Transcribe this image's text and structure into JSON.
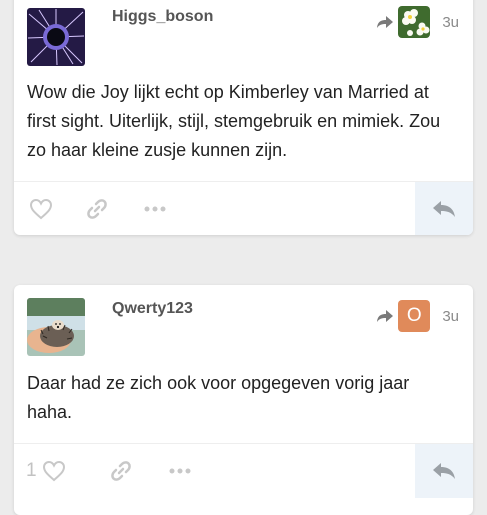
{
  "posts": [
    {
      "username": "Higgs_boson",
      "avatar_icon": "dark-sphere-avatar",
      "reply_to_avatar_icon": "white-flowers-avatar",
      "age": "3u",
      "body": "Wow die Joy lijkt echt op Kimberley van Married at first sight. Uiterlijk, stijl, stemgebruik en mimiek. Zou zo haar kleine zusje kunnen zijn.",
      "like_count": "",
      "icons": [
        "heart-icon",
        "link-icon",
        "more-icon",
        "reply-icon"
      ]
    },
    {
      "username": "Qwerty123",
      "avatar_icon": "hedgehog-avatar",
      "reply_to_letter": "O",
      "reply_to_color": "#e08a5a",
      "age": "3u",
      "body": "Daar had ze zich ook voor opgegeven vorig jaar haha.",
      "like_count": "1",
      "icons": [
        "heart-icon",
        "link-icon",
        "more-icon",
        "reply-icon"
      ]
    }
  ],
  "colors": {
    "background": "#ececec",
    "card": "#ffffff",
    "icon_gray": "#c8c8c8",
    "reply_button_bg": "#edf3f9"
  }
}
